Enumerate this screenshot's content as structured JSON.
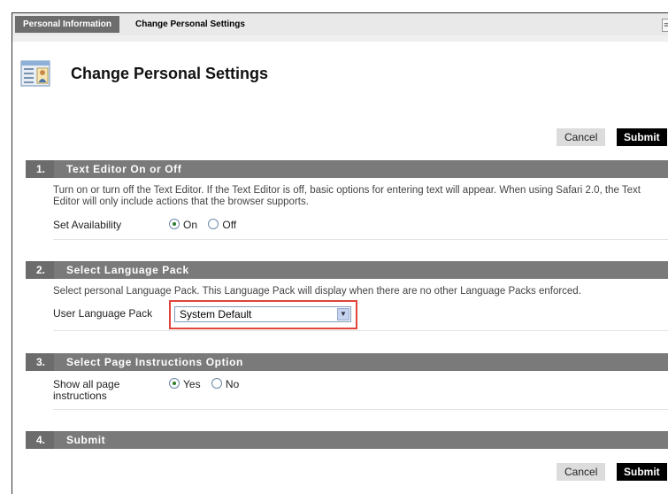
{
  "breadcrumb": {
    "items": [
      "Personal Information",
      "Change Personal Settings"
    ]
  },
  "page": {
    "title": "Change Personal Settings",
    "icon": "person-card-icon"
  },
  "actions": {
    "cancel_label": "Cancel",
    "submit_label": "Submit"
  },
  "steps": [
    {
      "number": "1.",
      "title": "Text Editor On or Off",
      "instructions": "Turn on or turn off the Text Editor. If the Text Editor is off, basic options for entering text will appear. When using Safari 2.0, the Text Editor will only include actions that the browser supports.",
      "field_label": "Set Availability",
      "options": [
        "On",
        "Off"
      ],
      "selected": "On"
    },
    {
      "number": "2.",
      "title": "Select Language Pack",
      "instructions": "Select personal Language Pack. This Language Pack will display when there are no other Language Packs enforced.",
      "field_label": "User Language Pack",
      "select_value": "System Default"
    },
    {
      "number": "3.",
      "title": "Select Page Instructions Option",
      "field_label": "Show all page instructions",
      "options": [
        "Yes",
        "No"
      ],
      "selected": "Yes"
    },
    {
      "number": "4.",
      "title": "Submit"
    }
  ],
  "colors": {
    "step_header": "#7a7a7a",
    "submit_button": "#000000",
    "highlight": "#e0443a"
  }
}
